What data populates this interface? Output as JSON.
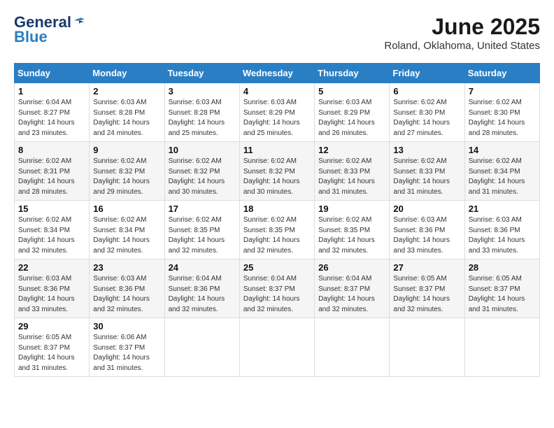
{
  "logo": {
    "general": "General",
    "blue": "Blue"
  },
  "title": {
    "month_year": "June 2025",
    "location": "Roland, Oklahoma, United States"
  },
  "headers": [
    "Sunday",
    "Monday",
    "Tuesday",
    "Wednesday",
    "Thursday",
    "Friday",
    "Saturday"
  ],
  "weeks": [
    [
      {
        "day": "1",
        "sunrise": "6:04 AM",
        "sunset": "8:27 PM",
        "daylight": "14 hours and 23 minutes."
      },
      {
        "day": "2",
        "sunrise": "6:03 AM",
        "sunset": "8:28 PM",
        "daylight": "14 hours and 24 minutes."
      },
      {
        "day": "3",
        "sunrise": "6:03 AM",
        "sunset": "8:28 PM",
        "daylight": "14 hours and 25 minutes."
      },
      {
        "day": "4",
        "sunrise": "6:03 AM",
        "sunset": "8:29 PM",
        "daylight": "14 hours and 25 minutes."
      },
      {
        "day": "5",
        "sunrise": "6:03 AM",
        "sunset": "8:29 PM",
        "daylight": "14 hours and 26 minutes."
      },
      {
        "day": "6",
        "sunrise": "6:02 AM",
        "sunset": "8:30 PM",
        "daylight": "14 hours and 27 minutes."
      },
      {
        "day": "7",
        "sunrise": "6:02 AM",
        "sunset": "8:30 PM",
        "daylight": "14 hours and 28 minutes."
      }
    ],
    [
      {
        "day": "8",
        "sunrise": "6:02 AM",
        "sunset": "8:31 PM",
        "daylight": "14 hours and 28 minutes."
      },
      {
        "day": "9",
        "sunrise": "6:02 AM",
        "sunset": "8:32 PM",
        "daylight": "14 hours and 29 minutes."
      },
      {
        "day": "10",
        "sunrise": "6:02 AM",
        "sunset": "8:32 PM",
        "daylight": "14 hours and 30 minutes."
      },
      {
        "day": "11",
        "sunrise": "6:02 AM",
        "sunset": "8:32 PM",
        "daylight": "14 hours and 30 minutes."
      },
      {
        "day": "12",
        "sunrise": "6:02 AM",
        "sunset": "8:33 PM",
        "daylight": "14 hours and 31 minutes."
      },
      {
        "day": "13",
        "sunrise": "6:02 AM",
        "sunset": "8:33 PM",
        "daylight": "14 hours and 31 minutes."
      },
      {
        "day": "14",
        "sunrise": "6:02 AM",
        "sunset": "8:34 PM",
        "daylight": "14 hours and 31 minutes."
      }
    ],
    [
      {
        "day": "15",
        "sunrise": "6:02 AM",
        "sunset": "8:34 PM",
        "daylight": "14 hours and 32 minutes."
      },
      {
        "day": "16",
        "sunrise": "6:02 AM",
        "sunset": "8:34 PM",
        "daylight": "14 hours and 32 minutes."
      },
      {
        "day": "17",
        "sunrise": "6:02 AM",
        "sunset": "8:35 PM",
        "daylight": "14 hours and 32 minutes."
      },
      {
        "day": "18",
        "sunrise": "6:02 AM",
        "sunset": "8:35 PM",
        "daylight": "14 hours and 32 minutes."
      },
      {
        "day": "19",
        "sunrise": "6:02 AM",
        "sunset": "8:35 PM",
        "daylight": "14 hours and 32 minutes."
      },
      {
        "day": "20",
        "sunrise": "6:03 AM",
        "sunset": "8:36 PM",
        "daylight": "14 hours and 33 minutes."
      },
      {
        "day": "21",
        "sunrise": "6:03 AM",
        "sunset": "8:36 PM",
        "daylight": "14 hours and 33 minutes."
      }
    ],
    [
      {
        "day": "22",
        "sunrise": "6:03 AM",
        "sunset": "8:36 PM",
        "daylight": "14 hours and 33 minutes."
      },
      {
        "day": "23",
        "sunrise": "6:03 AM",
        "sunset": "8:36 PM",
        "daylight": "14 hours and 32 minutes."
      },
      {
        "day": "24",
        "sunrise": "6:04 AM",
        "sunset": "8:36 PM",
        "daylight": "14 hours and 32 minutes."
      },
      {
        "day": "25",
        "sunrise": "6:04 AM",
        "sunset": "8:37 PM",
        "daylight": "14 hours and 32 minutes."
      },
      {
        "day": "26",
        "sunrise": "6:04 AM",
        "sunset": "8:37 PM",
        "daylight": "14 hours and 32 minutes."
      },
      {
        "day": "27",
        "sunrise": "6:05 AM",
        "sunset": "8:37 PM",
        "daylight": "14 hours and 32 minutes."
      },
      {
        "day": "28",
        "sunrise": "6:05 AM",
        "sunset": "8:37 PM",
        "daylight": "14 hours and 31 minutes."
      }
    ],
    [
      {
        "day": "29",
        "sunrise": "6:05 AM",
        "sunset": "8:37 PM",
        "daylight": "14 hours and 31 minutes."
      },
      {
        "day": "30",
        "sunrise": "6:06 AM",
        "sunset": "8:37 PM",
        "daylight": "14 hours and 31 minutes."
      },
      null,
      null,
      null,
      null,
      null
    ]
  ],
  "labels": {
    "sunrise": "Sunrise:",
    "sunset": "Sunset:",
    "daylight": "Daylight:"
  }
}
